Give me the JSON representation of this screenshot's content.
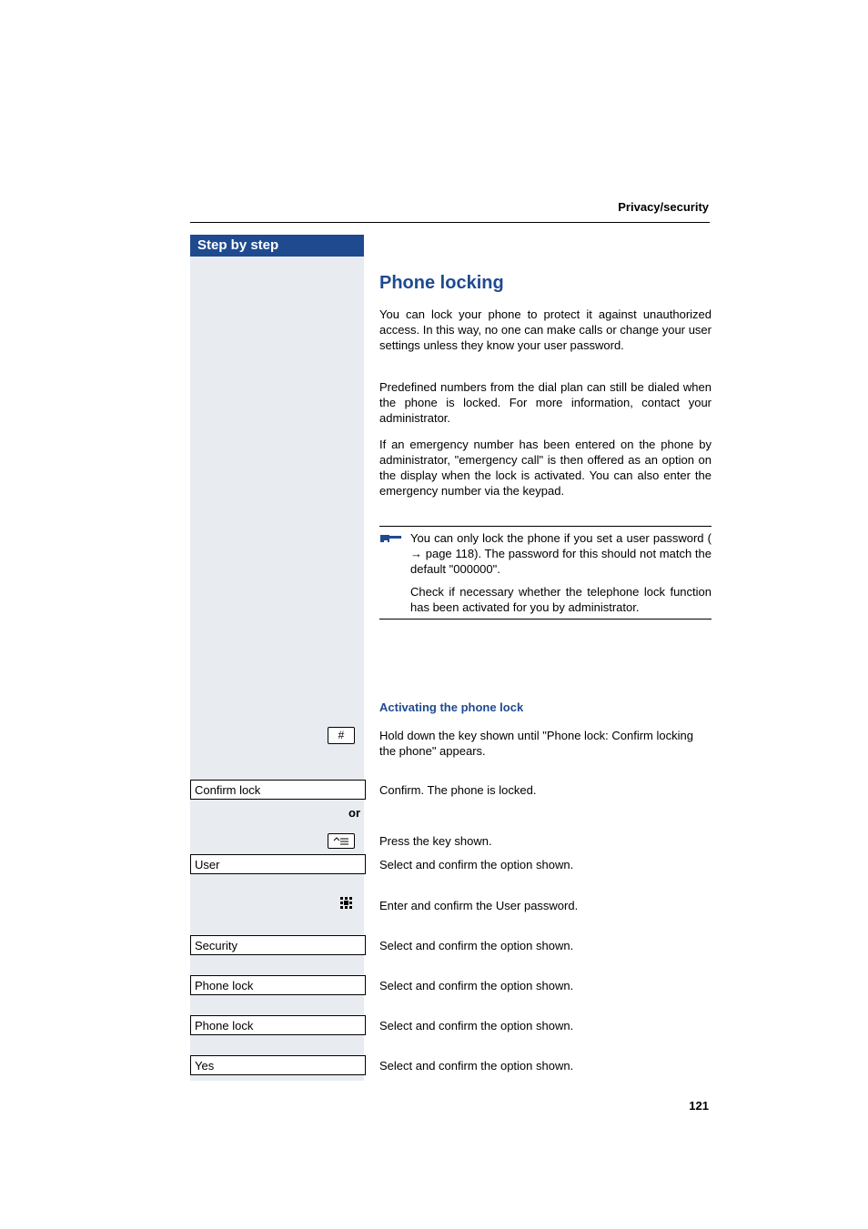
{
  "header": {
    "section": "Privacy/security"
  },
  "sidebar": {
    "title": "Step by step"
  },
  "main": {
    "heading": "Phone locking",
    "para1": "You can lock your phone to protect it against unauthorized access. In this way, no one can make calls or change your user settings unless they know your user password.",
    "para2": "Predefined numbers from the dial plan can still be dialed when the phone is locked. For more information, contact your administrator.",
    "para3": "If an emergency number has been entered on the phone by administrator, \"emergency call\" is then offered as an option on the display when the lock is activated. You can also enter the emergency number via the keypad.",
    "note1_a": "You can only lock the phone if you set a user password (",
    "note1_b": " page 118). The password for this should not match the default \"000000\".",
    "note2": "Check if necessary whether the telephone lock function has been activated for you by administrator.",
    "subheading": "Activating the phone lock",
    "hash_key": "#",
    "instr_hold": "Hold down the key shown until \"Phone lock: Confirm locking the phone\" appears.",
    "disp_confirm_lock": "Confirm lock",
    "instr_confirm": "Confirm. The phone is locked.",
    "or": "or",
    "instr_press_key": "Press the key shown.",
    "disp_user": "User",
    "instr_select_user": "Select and confirm the option shown.",
    "instr_enter_pw": "Enter and confirm the User password.",
    "disp_security": "Security",
    "instr_select_security": "Select and confirm the option shown.",
    "disp_phone_lock1": "Phone lock",
    "instr_select_pl1": "Select and confirm the option shown.",
    "disp_phone_lock2": "Phone lock",
    "instr_select_pl2": "Select and confirm the option shown.",
    "disp_yes": "Yes",
    "instr_select_yes": "Select and confirm the option shown."
  },
  "footer": {
    "page": "121"
  }
}
